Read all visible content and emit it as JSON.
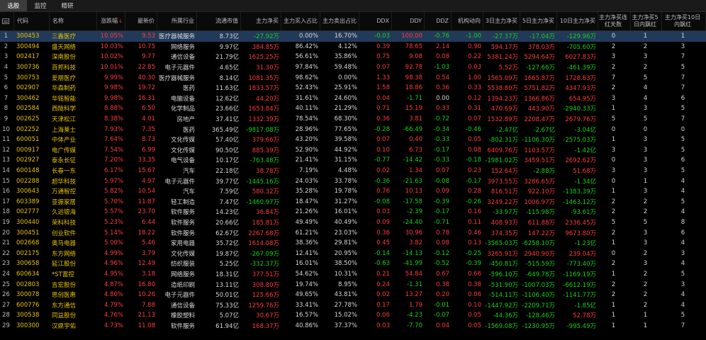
{
  "tabs": [
    {
      "label": "选股",
      "active": true
    },
    {
      "label": "监控",
      "active": false
    },
    {
      "label": "精研",
      "active": false
    }
  ],
  "headers": [
    "",
    "代码",
    "名称",
    "涨跌幅",
    "最新价",
    "所属行业",
    "流通市值",
    "主力净买",
    "主力买入占比",
    "主力卖出占比",
    "DDX",
    "DDY",
    "DDZ",
    "机构动向",
    "3日主力净买",
    "5日主力净买",
    "10日主力净买",
    "主力净买连红天数",
    "主力净买5日内飘红",
    "主力净买10日内飘红"
  ],
  "sort_indicator": "↓",
  "rows": [
    [
      "1",
      "300453",
      "三鑫医疗",
      "10.05%",
      "9.53",
      "医疗器械服务",
      "8.73亿",
      "-27.92万",
      "0.00%",
      "16.70%",
      "-0.03",
      "100.00",
      "-0.76",
      "-1.00",
      "-27.37万",
      "-17.04万",
      "-129.96万",
      "0",
      "1",
      "1"
    ],
    [
      "2",
      "300494",
      "盛天网络",
      "10.03%",
      "10.75",
      "网络服务",
      "9.97亿",
      "384.85万",
      "86.42%",
      "4.12%",
      "0.39",
      "78.65",
      "2.14",
      "0.90",
      "594.17万",
      "378.03万",
      "-705.60万",
      "2",
      "2",
      "3"
    ],
    [
      "3",
      "002417",
      "深南股份",
      "10.02%",
      "9.77",
      "通信设备",
      "21.79亿",
      "1625.25万",
      "56.61%",
      "35.86%",
      "0.75",
      "9.08",
      "0.08",
      "0.22",
      "5381.24万",
      "5294.64万",
      "6027.83万",
      "3",
      "3",
      "7"
    ],
    [
      "4",
      "300736",
      "百邦科技",
      "10.01%",
      "22.85",
      "电子元器件",
      "4.65亿",
      "31.30万",
      "97.84%",
      "59.48%",
      "0.07",
      "92.78",
      "-1.03",
      "0.03",
      "5.52万",
      "-127.66万",
      "-461.39万",
      "2",
      "2",
      "5"
    ],
    [
      "5",
      "300753",
      "爱朋医疗",
      "9.99%",
      "40.30",
      "医疗器械服务",
      "8.14亿",
      "1081.35万",
      "98.62%",
      "0.00%",
      "1.33",
      "98.38",
      "0.54",
      "1.00",
      "1565.09万",
      "1665.87万",
      "1728.63万",
      "7",
      "5",
      "7"
    ],
    [
      "6",
      "002907",
      "华森制药",
      "9.98%",
      "19.72",
      "医药",
      "11.63亿",
      "1833.57万",
      "52.43%",
      "25.91%",
      "1.58",
      "18.86",
      "0.36",
      "0.33",
      "5538.80万",
      "5751.82万",
      "4347.93万",
      "2",
      "4",
      "7"
    ],
    [
      "7",
      "300462",
      "华铭智能",
      "9.98%",
      "16.31",
      "电脑设备",
      "12.62亿",
      "44.20万",
      "31.61%",
      "24.60%",
      "0.04",
      "-1.71",
      "0.00",
      "0.12",
      "1394.23万",
      "1366.86万",
      "654.95万",
      "3",
      "4",
      "6"
    ],
    [
      "8",
      "002584",
      "西陇科学",
      "8.88%",
      "6.50",
      "化学制品",
      "23.66亿",
      "1653.84万",
      "40.11%",
      "21.29%",
      "0.71",
      "15.19",
      "0.33",
      "0.31",
      "470.69万",
      "443.90万",
      "-2940.33万",
      "1",
      "3",
      "5"
    ],
    [
      "9",
      "002625",
      "天津松江",
      "8.38%",
      "4.01",
      "房地产",
      "37.41亿",
      "1332.39万",
      "78.54%",
      "68.30%",
      "0.36",
      "3.81",
      "-0.72",
      "0.07",
      "1532.89万",
      "2208.47万",
      "2679.76万",
      "5",
      "5",
      "7"
    ],
    [
      "10",
      "002252",
      "上海莱士",
      "7.93%",
      "7.35",
      "医药",
      "365.49亿",
      "-9817.08万",
      "28.96%",
      "77.65%",
      "-0.28",
      "-66.49",
      "-0.34",
      "-0.46",
      "-2.47亿",
      "-2.67亿",
      "-3.04亿",
      "0",
      "0",
      "0"
    ],
    [
      "11",
      "600051",
      "中体产业",
      "7.64%",
      "8.73",
      "文化传媒",
      "57.40亿",
      "379.66万",
      "43.20%",
      "39.58%",
      "0.07",
      "0.40",
      "-0.33",
      "0.05",
      "-802.31万",
      "-1106.30万",
      "-2575.03万",
      "1",
      "3",
      "5"
    ],
    [
      "12",
      "000917",
      "电广传媒",
      "7.54%",
      "6.99",
      "文化传媒",
      "90.50亿",
      "885.39万",
      "52.90%",
      "44.92%",
      "0.10",
      "6.73",
      "-0.17",
      "0.08",
      "6409.76万",
      "1103.57万",
      "-1.42亿",
      "3",
      "3",
      "5"
    ],
    [
      "13",
      "002927",
      "泰永长征",
      "7.20%",
      "33.35",
      "电气设备",
      "10.17亿",
      "-763.48万",
      "21.41%",
      "31.15%",
      "-0.77",
      "-14.42",
      "-0.33",
      "-0.18",
      "-1981.02万",
      "3459.51万",
      "2692.62万",
      "0",
      "3",
      "6"
    ],
    [
      "14",
      "600148",
      "长春一东",
      "6.17%",
      "15.67",
      "汽车",
      "22.18亿",
      "38.78万",
      "7.19%",
      "4.48%",
      "0.02",
      "1.34",
      "0.07",
      "0.23",
      "152.64万",
      "-2.88万",
      "51.68万",
      "3",
      "3",
      "5"
    ],
    [
      "15",
      "002288",
      "超华科技",
      "5.97%",
      "4.97",
      "电子元器件",
      "39.77亿",
      "-1445.16万",
      "24.03%",
      "33.78%",
      "-0.36",
      "-21.63",
      "-0.08",
      "-0.17",
      "3973.55万",
      "3286.65万",
      "-1.34亿",
      "0",
      "1",
      "4"
    ],
    [
      "16",
      "300643",
      "万通智控",
      "5.82%",
      "10.54",
      "汽车",
      "7.59亿",
      "580.32万",
      "35.28%",
      "19.78%",
      "0.76",
      "10.13",
      "0.09",
      "0.28",
      "816.51万",
      "922.10万",
      "-1383.39万",
      "1",
      "3",
      "4"
    ],
    [
      "17",
      "603389",
      "亚振家居",
      "5.70%",
      "11.87",
      "轻工制造",
      "7.47亿",
      "-1460.97万",
      "18.47%",
      "31.27%",
      "-0.08",
      "-17.58",
      "-0.39",
      "-0.26",
      "3249.22万",
      "1006.97万",
      "-1463.12万",
      "2",
      "2",
      "5"
    ],
    [
      "18",
      "002777",
      "久远银海",
      "5.57%",
      "23.70",
      "软件服务",
      "14.23亿",
      "36.84万",
      "21.26%",
      "16.01%",
      "0.03",
      "-2.39",
      "-0.17",
      "0.16",
      "-33.97万",
      "-115.98万",
      "-93.61万",
      "2",
      "2",
      "4"
    ],
    [
      "19",
      "300440",
      "荣科科技",
      "5.23%",
      "6.44",
      "软件服务",
      "20.66亿",
      "185.81万",
      "49.49%",
      "40.49%",
      "0.09",
      "-24.40",
      "-0.71",
      "0.11",
      "408.93万",
      "611.88万",
      "2336.45万",
      "5",
      "5",
      "8"
    ],
    [
      "20",
      "300451",
      "创业软件",
      "5.14%",
      "18.22",
      "软件服务",
      "62.67亿",
      "2267.68万",
      "61.21%",
      "23.03%",
      "0.36",
      "30.96",
      "0.78",
      "0.46",
      "374.35万",
      "147.22万",
      "9673.80万",
      "2",
      "3",
      "6"
    ],
    [
      "21",
      "002668",
      "奥马电器",
      "5.00%",
      "5.46",
      "家用电器",
      "35.72亿",
      "1614.08万",
      "38.36%",
      "29.81%",
      "0.45",
      "3.82",
      "0.08",
      "0.13",
      "-3565.03万",
      "-6258.10万",
      "-1.23亿",
      "1",
      "3",
      "4"
    ],
    [
      "22",
      "002175",
      "东方网络",
      "4.99%",
      "3.79",
      "文化传媒",
      "19.87亿",
      "-267.09万",
      "12.41%",
      "20.95%",
      "-0.14",
      "-14.13",
      "-0.12",
      "-0.25",
      "3265.91万",
      "2940.90万",
      "239.04万",
      "0",
      "2",
      "3"
    ],
    [
      "23",
      "300658",
      "延江股份",
      "4.96%",
      "12.49",
      "纺织服装",
      "5.25亿",
      "-332.37万",
      "16.01%",
      "38.50%",
      "-0.63",
      "-41.99",
      "-0.52",
      "-0.39",
      "-450.81万",
      "-515.59万",
      "-773.40万",
      "2",
      "3",
      "4"
    ],
    [
      "24",
      "600634",
      "*ST富控",
      "4.95%",
      "3.18",
      "网络服务",
      "18.31亿",
      "377.51万",
      "54.62%",
      "10.31%",
      "0.21",
      "54.84",
      "0.67",
      "0.66",
      "-596.10万",
      "-649.78万",
      "-1169.19万",
      "1",
      "2",
      "5"
    ],
    [
      "25",
      "002803",
      "吉宏股份",
      "4.87%",
      "16.80",
      "造纸印刷",
      "13.11亿",
      "308.80万",
      "19.74%",
      "8.95%",
      "0.24",
      "-1.31",
      "0.38",
      "0.38",
      "-531.90万",
      "-1007.03万",
      "-6612.19万",
      "2",
      "2",
      "3"
    ],
    [
      "26",
      "300078",
      "思创医惠",
      "4.80%",
      "10.26",
      "电子元器件",
      "50.01亿",
      "125.66万",
      "49.65%",
      "43.81%",
      "0.02",
      "13.27",
      "0.20",
      "0.06",
      "-514.11万",
      "-1106.40万",
      "-1141.77万",
      "2",
      "2",
      "4"
    ],
    [
      "27",
      "600776",
      "东方通信",
      "4.79%",
      "7.88",
      "通信设备",
      "75.33亿",
      "1259.76万",
      "33.41%",
      "27.78%",
      "0.17",
      "1.79",
      "-0.01",
      "0.10",
      "-1447.92万",
      "-2209.71万",
      "-1.85亿",
      "1",
      "2",
      "4"
    ],
    [
      "28",
      "300538",
      "同益股份",
      "4.76%",
      "21.13",
      "橡胶塑料",
      "5.07亿",
      "30.67万",
      "16.57%",
      "15.02%",
      "0.06",
      "-4.23",
      "-0.07",
      "0.05",
      "-44.36万",
      "-128.46万",
      "52.78万",
      "1",
      "1",
      "5"
    ],
    [
      "29",
      "300300",
      "汉鼎宇佑",
      "4.73%",
      "11.08",
      "软件服务",
      "61.94亿",
      "168.37万",
      "40.86%",
      "37.37%",
      "0.03",
      "-7.70",
      "0.04",
      "0.05",
      "-1569.08万",
      "-1230.95万",
      "-995.49万",
      "1",
      "1",
      "7"
    ]
  ],
  "colors": {
    "up": "#ff3b3b",
    "down": "#16d416",
    "name": "#e8c200",
    "selected_row": "#223a5a"
  },
  "header_icon": "menu-icon"
}
